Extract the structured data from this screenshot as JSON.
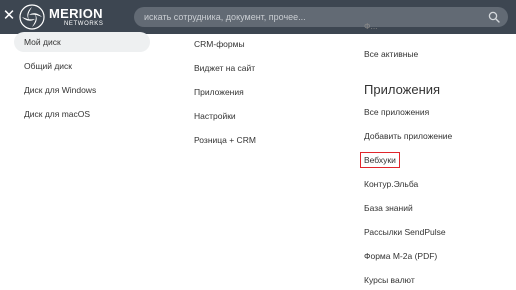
{
  "header": {
    "close_label": "✕",
    "logo_name": "MERION",
    "logo_sub": "NETWORKS",
    "search_placeholder": "искать сотрудника, документ, прочее..."
  },
  "column1": {
    "items": [
      {
        "label": "Мой диск",
        "active": true
      },
      {
        "label": "Общий диск"
      },
      {
        "label": "Диск для Windows"
      },
      {
        "label": "Диск для macOS"
      }
    ]
  },
  "column2": {
    "items": [
      {
        "label": "CRM-формы"
      },
      {
        "label": "Виджет на сайт"
      },
      {
        "label": "Приложения"
      },
      {
        "label": "Настройки"
      },
      {
        "label": "Розница + CRM"
      }
    ]
  },
  "column3": {
    "partial_top_label": "Ф...",
    "all_active": "Все активные",
    "section_title": "Приложения",
    "items": [
      {
        "label": "Все приложения"
      },
      {
        "label": "Добавить приложение"
      },
      {
        "label": "Вебхуки",
        "highlighted": true
      },
      {
        "label": "Контур.Эльба"
      },
      {
        "label": "База знаний"
      },
      {
        "label": "Рассылки SendPulse"
      },
      {
        "label": "Форма М-2а (PDF)"
      },
      {
        "label": "Курсы валют"
      }
    ]
  },
  "colors": {
    "topbar": "#3d4651",
    "search_bg": "#626a74",
    "highlight_border": "#e0262c",
    "active_item_bg": "#eef0f1"
  }
}
